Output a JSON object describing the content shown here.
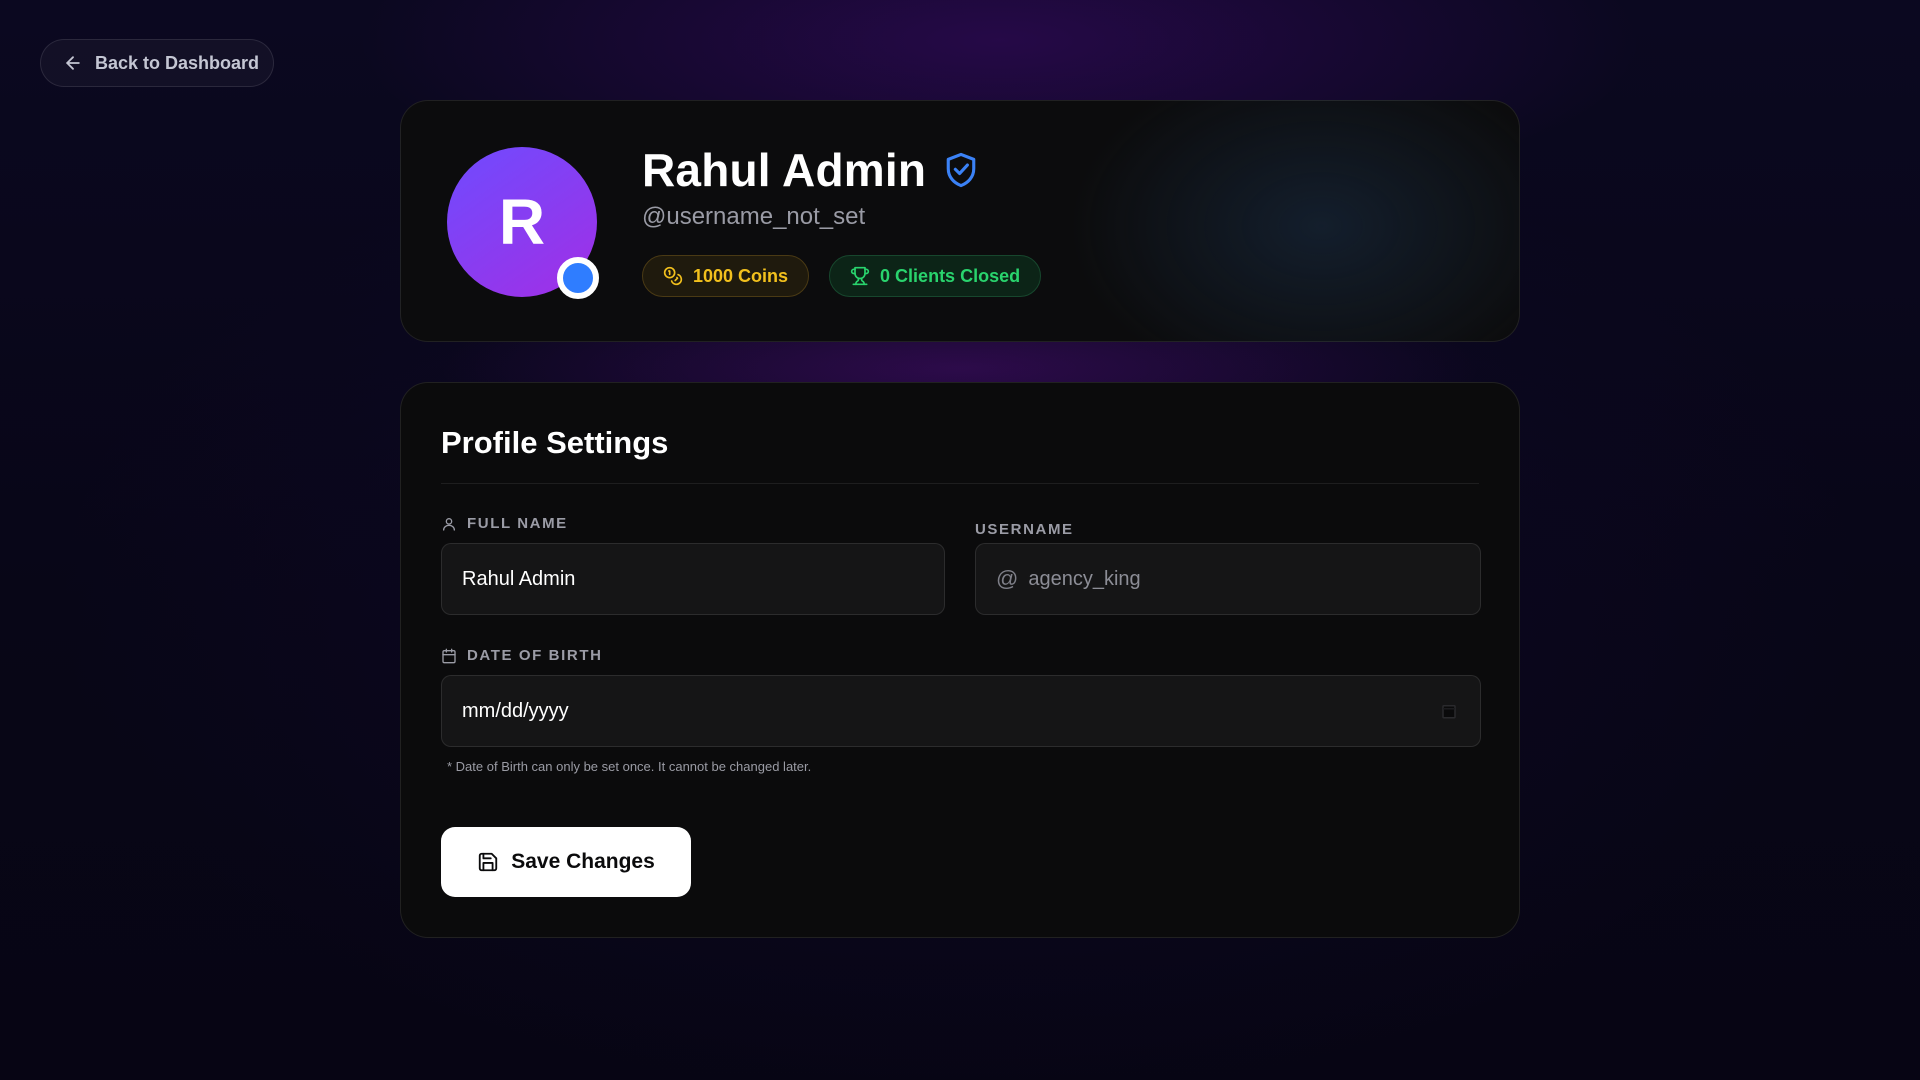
{
  "nav": {
    "back_label": "Back to Dashboard"
  },
  "profile": {
    "avatar_initial": "R",
    "name": "Rahul Admin",
    "handle": "@username_not_set",
    "coins_label": "1000 Coins",
    "clients_label": "0 Clients Closed",
    "status_color": "#2f7dff",
    "verified_icon": "shield-check-icon"
  },
  "settings": {
    "title": "Profile Settings",
    "full_name": {
      "label": "Full Name",
      "value": "Rahul Admin"
    },
    "username": {
      "label": "Username",
      "prefix": "@",
      "placeholder": "agency_king"
    },
    "dob": {
      "label": "Date of Birth",
      "placeholder": "mm/dd/yyyy"
    },
    "dob_hint": "* Date of Birth can only be set once. It cannot be changed later.",
    "save_label": "Save Changes"
  },
  "colors": {
    "coins": "#f2c01d",
    "clients": "#29d36d",
    "verified": "#3b82f6",
    "avatar_gradient": [
      "#6f4bff",
      "#a22ee6"
    ]
  }
}
